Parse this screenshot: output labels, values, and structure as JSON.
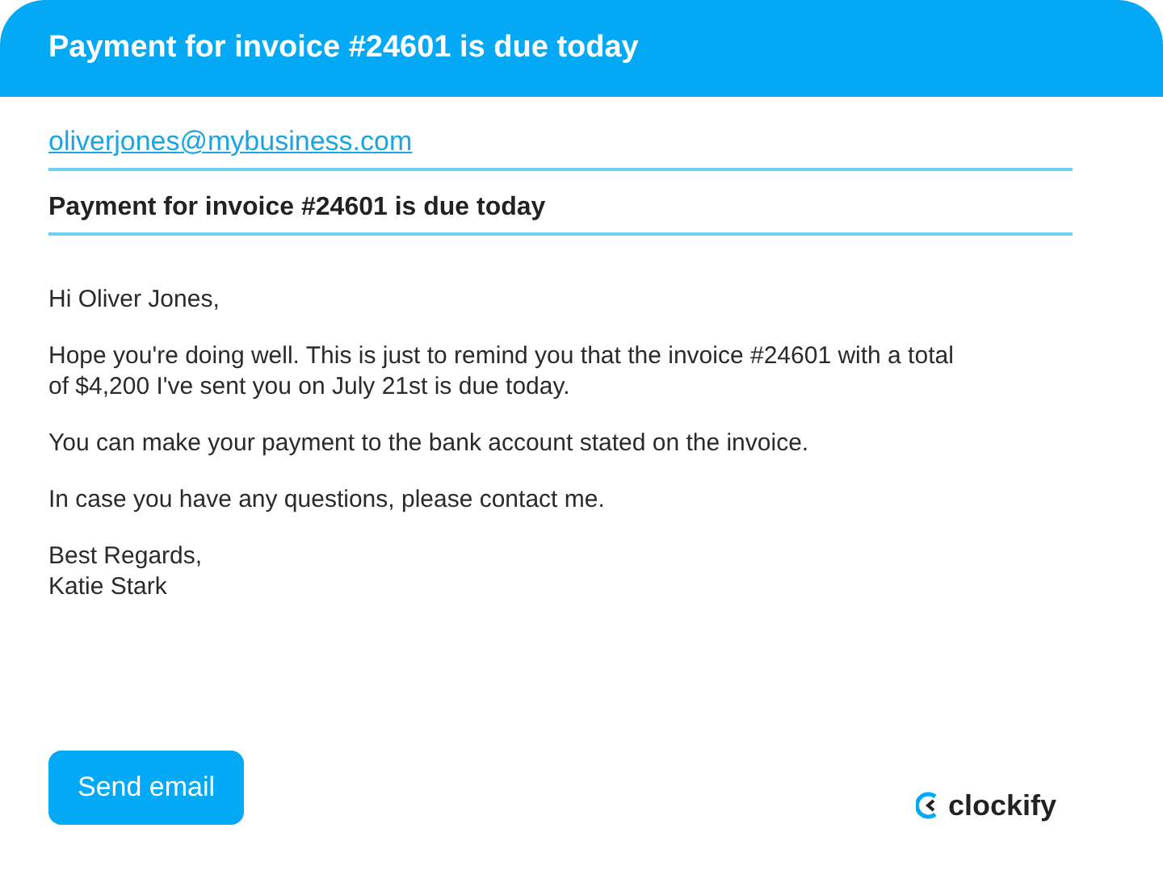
{
  "header": {
    "title": "Payment for invoice #24601 is due today"
  },
  "to": {
    "value": "oliverjones@mybusiness.com"
  },
  "subject": {
    "value": "Payment for invoice #24601 is due today"
  },
  "body": [
    {
      "lines": [
        "Hi Oliver Jones,"
      ]
    },
    {
      "lines": [
        "Hope you're doing well. This is just to remind you that the invoice #24601 with a total",
        "of $4,200 I've sent you on July 21st is due today."
      ]
    },
    {
      "lines": [
        "You can make your payment to the bank account stated on the invoice."
      ]
    },
    {
      "lines": [
        "In case you have any questions, please contact me."
      ]
    },
    {
      "lines": [
        "Best Regards,",
        "Katie Stark"
      ]
    }
  ],
  "button": "Send email",
  "logo": "clockify"
}
